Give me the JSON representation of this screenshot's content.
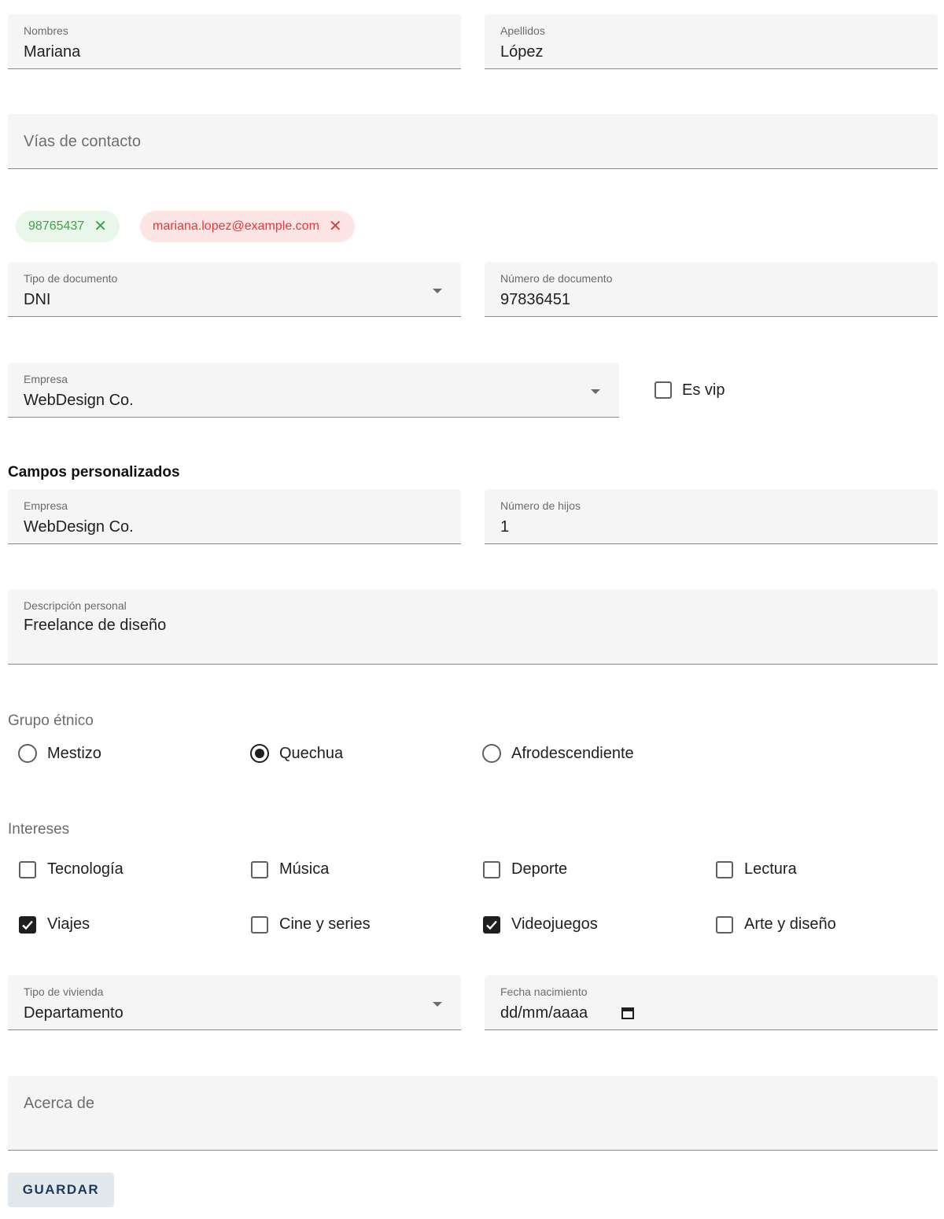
{
  "form": {
    "nombres": {
      "label": "Nombres",
      "value": "Mariana"
    },
    "apellidos": {
      "label": "Apellidos",
      "value": "López"
    },
    "vias_contacto": {
      "placeholder": "Vías de contacto"
    },
    "chips": [
      {
        "label": "98765437",
        "color": "#3ea34a"
      },
      {
        "label": "mariana.lopez@example.com",
        "color": "#e53935"
      }
    ],
    "tipo_documento": {
      "label": "Tipo de documento",
      "value": "DNI",
      "icon": "chevron-down-icon"
    },
    "numero_documento": {
      "label": "Número de documento",
      "value": "97836451"
    },
    "empresa": {
      "label": "Empresa",
      "value": "WebDesign Co.",
      "icon": "chevron-down-icon"
    },
    "es_vip": {
      "label": "Es vip",
      "checked": false
    }
  },
  "custom": {
    "title": "Campos personalizados",
    "empresa": {
      "label": "Empresa",
      "value": "WebDesign Co."
    },
    "numero_hijos": {
      "label": "Número de hijos",
      "value": "1"
    },
    "descripcion": {
      "label": "Descripción personal",
      "value": "Freelance de diseño"
    },
    "grupo_etnico": {
      "title": "Grupo étnico",
      "options": [
        {
          "label": "Mestizo",
          "selected": false
        },
        {
          "label": "Quechua",
          "selected": true
        },
        {
          "label": "Afrodescendiente",
          "selected": false
        }
      ]
    },
    "intereses": {
      "title": "Intereses",
      "options": [
        {
          "label": "Tecnología",
          "checked": false
        },
        {
          "label": "Música",
          "checked": false
        },
        {
          "label": "Deporte",
          "checked": false
        },
        {
          "label": "Lectura",
          "checked": false
        },
        {
          "label": "Viajes",
          "checked": true
        },
        {
          "label": "Cine y series",
          "checked": false
        },
        {
          "label": "Videojuegos",
          "checked": true
        },
        {
          "label": "Arte y diseño",
          "checked": false
        }
      ]
    },
    "tipo_vivienda": {
      "label": "Tipo de vivienda",
      "value": "Departamento",
      "icon": "chevron-down-icon"
    },
    "fecha_nacimiento": {
      "label": "Fecha nacimiento",
      "value": "dd/mm/aaaa",
      "icon": "calendar-icon"
    },
    "acerca_de": {
      "placeholder": "Acerca de"
    }
  },
  "actions": {
    "save_label": "GUARDAR"
  },
  "colors": {
    "chip_green": "#3ea34a",
    "chip_red": "#e53935",
    "button_text": "#1d3a5c"
  }
}
